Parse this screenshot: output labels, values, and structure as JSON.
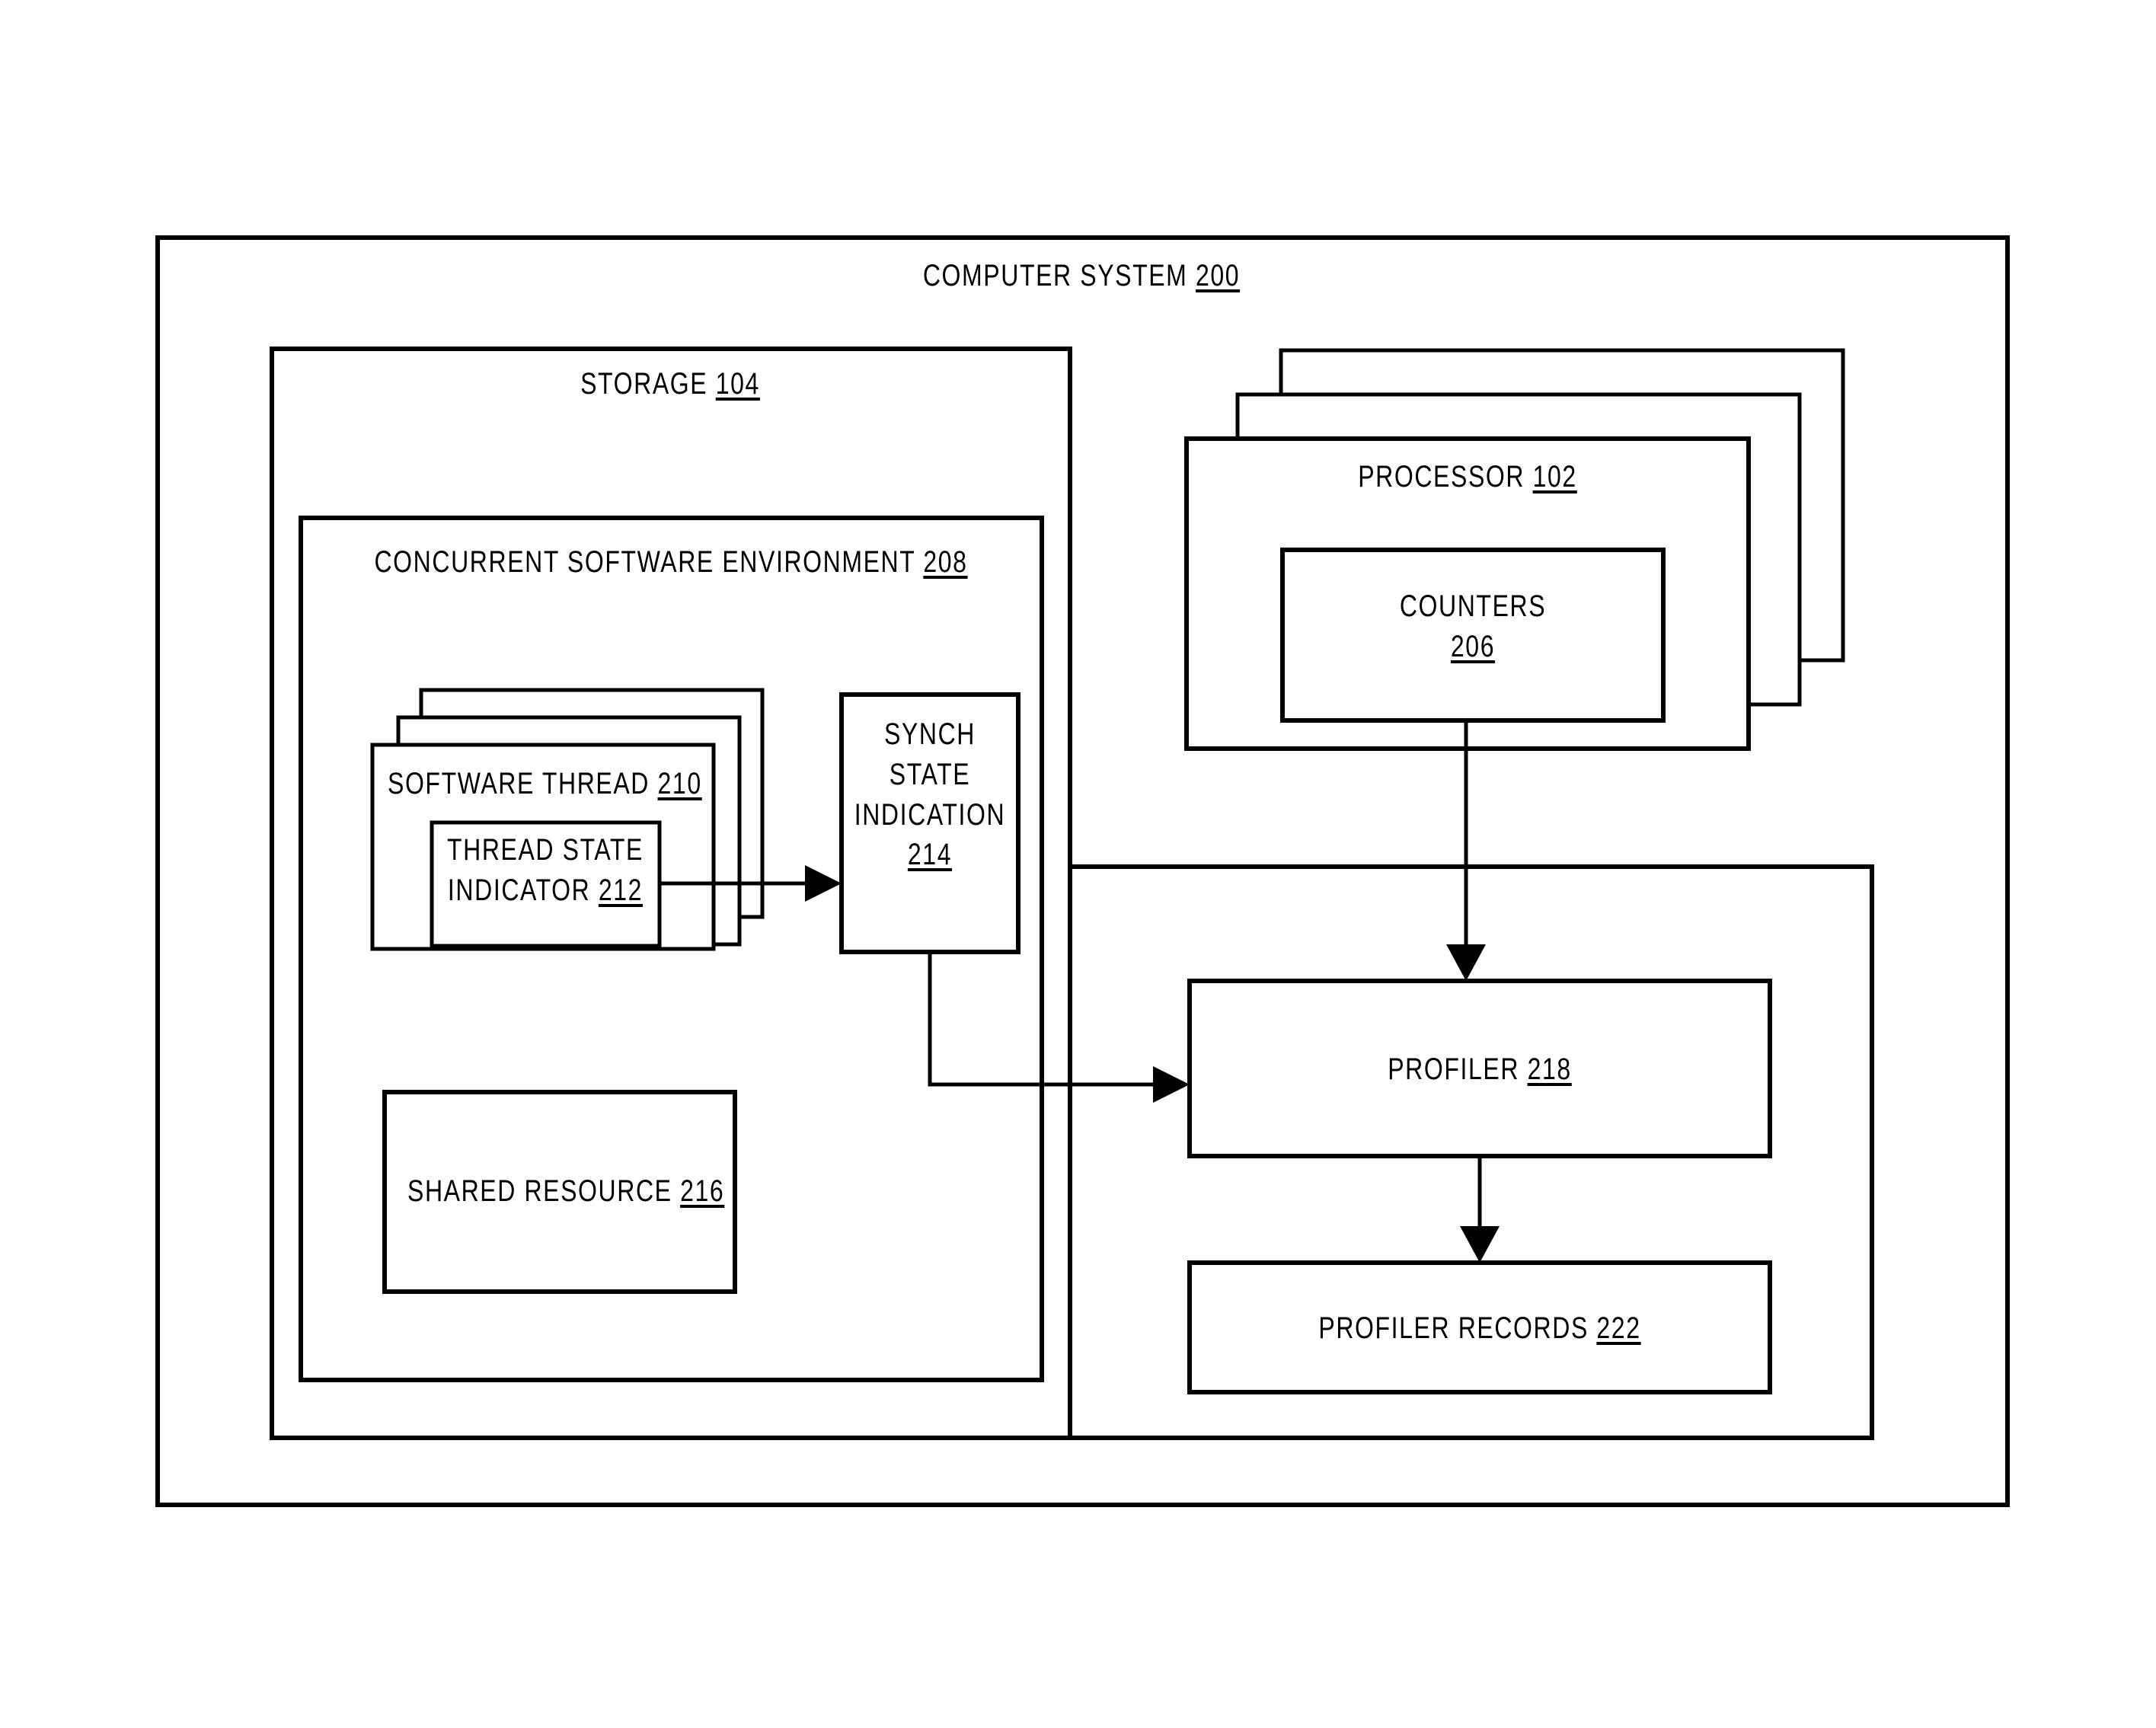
{
  "figure": {
    "type": "patent-block-diagram",
    "background": "#ffffff",
    "line_color": "#000000"
  },
  "outer": {
    "title": "COMPUTER SYSTEM",
    "ref": "200"
  },
  "storage": {
    "title": "STORAGE",
    "ref": "104"
  },
  "environment": {
    "title": "CONCURRENT SOFTWARE ENVIRONMENT",
    "ref": "208"
  },
  "software_thread": {
    "title": "SOFTWARE THREAD",
    "ref": "210",
    "stack_count": 3
  },
  "thread_state_indicator": {
    "line1": "THREAD STATE",
    "line2": "INDICATOR",
    "ref": "212"
  },
  "synch_state_indication": {
    "line1": "SYNCH",
    "line2": "STATE",
    "line3": "INDICATION",
    "ref": "214"
  },
  "shared_resource": {
    "title": "SHARED RESOURCE",
    "ref": "216"
  },
  "processor": {
    "title": "PROCESSOR",
    "ref": "102",
    "stack_count": 3
  },
  "counters": {
    "title": "COUNTERS",
    "ref": "206"
  },
  "profiler": {
    "title": "PROFILER",
    "ref": "218"
  },
  "profiler_records": {
    "title": "PROFILER RECORDS",
    "ref": "222"
  },
  "connections": [
    {
      "name": "thread-state-indicator-to-synch-state-indication",
      "from": "212",
      "to": "214",
      "arrow": true
    },
    {
      "name": "synch-state-indication-to-profiler",
      "from": "214",
      "to": "218",
      "arrow": true
    },
    {
      "name": "counters-to-profiler",
      "from": "206",
      "to": "218",
      "arrow": true
    },
    {
      "name": "profiler-to-profiler-records",
      "from": "218",
      "to": "222",
      "arrow": true
    }
  ]
}
